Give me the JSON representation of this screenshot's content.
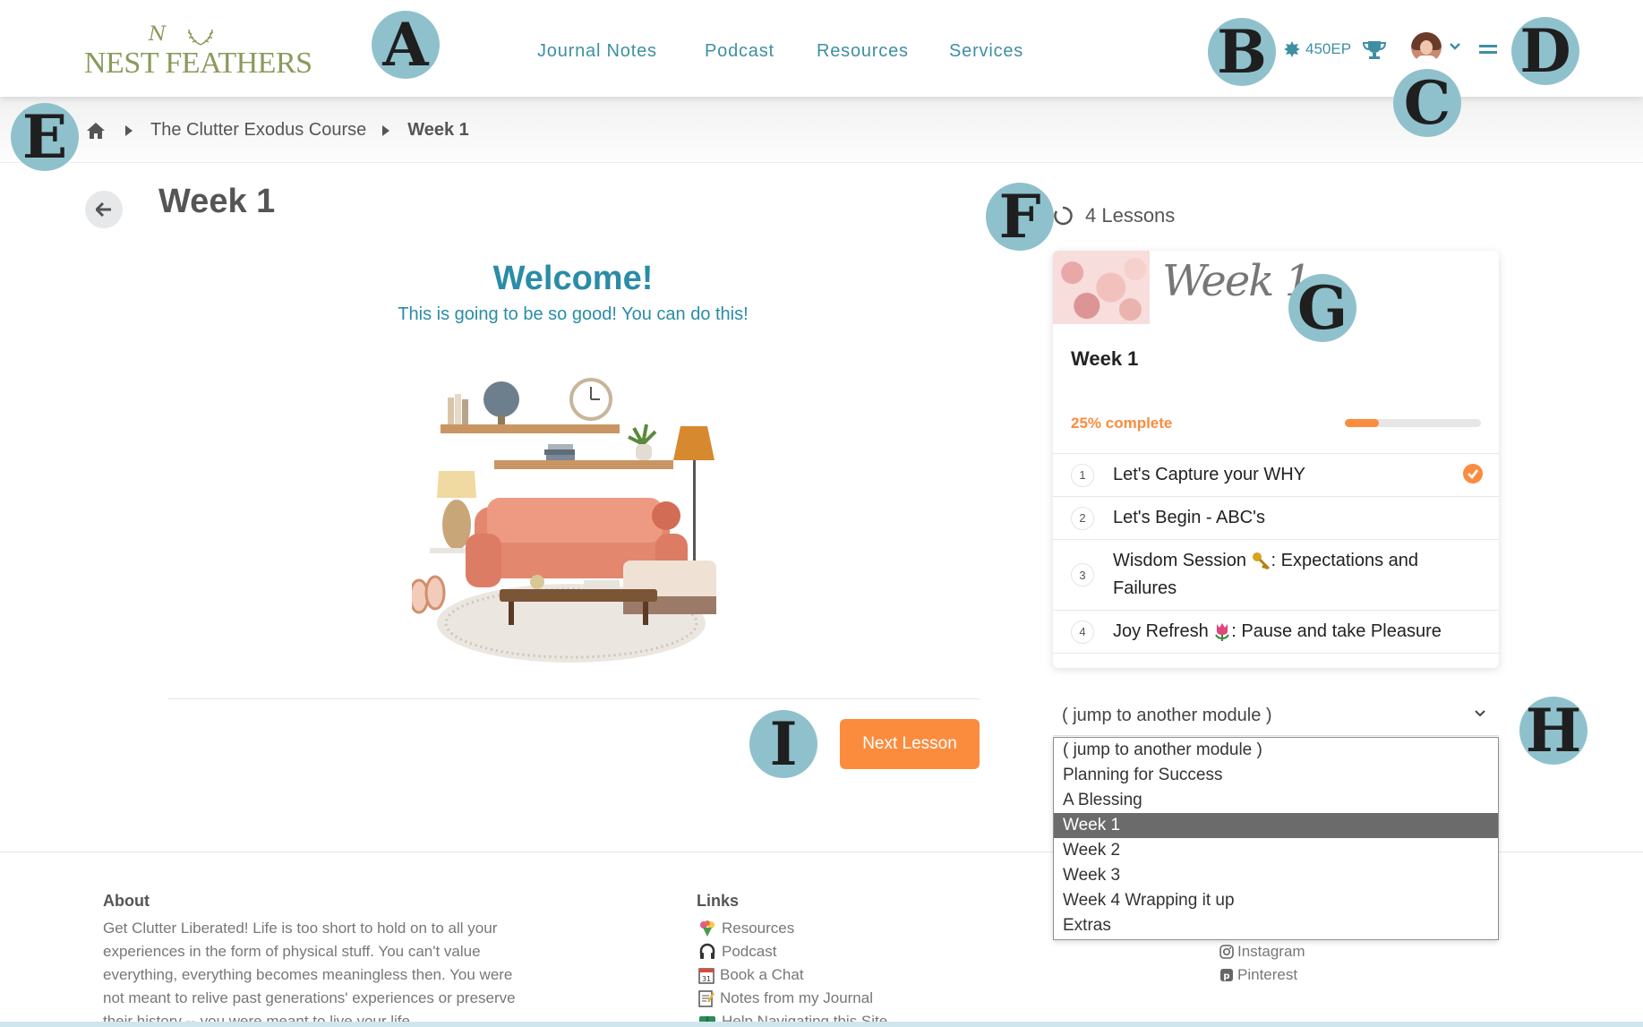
{
  "header": {
    "logo_monogram": "N",
    "logo_text": "NEST FEATHERS",
    "nav": [
      {
        "label": "Journal Notes"
      },
      {
        "label": "Podcast"
      },
      {
        "label": "Resources"
      },
      {
        "label": "Services"
      }
    ],
    "ep_label": "450EP",
    "accent_color": "#3f8fa3"
  },
  "breadcrumb": {
    "items": [
      "The Clutter Exodus Course",
      "Week 1"
    ]
  },
  "page": {
    "title": "Week 1",
    "welcome_heading": "Welcome!",
    "welcome_sub": "This is going to be so good!  You can do this!",
    "next_button": "Next Lesson"
  },
  "lessons_panel": {
    "count_label": "4 Lessons",
    "banner_script": "Week 1",
    "card_title": "Week 1",
    "progress_label": "25% complete",
    "progress_percent": 25,
    "progress_color": "#fb8c3e",
    "lessons": [
      {
        "num": "1",
        "text": "Let's Capture your WHY",
        "complete": true
      },
      {
        "num": "2",
        "text": "Let's Begin - ABC's",
        "complete": false
      },
      {
        "num": "3",
        "text_a": "Wisdom Session ",
        "icon": "key-icon",
        "text_b": ": Expectations and Failures",
        "complete": false
      },
      {
        "num": "4",
        "text_a": "Joy Refresh ",
        "icon": "tulip-icon",
        "text_b": ": Pause and take Pleasure",
        "complete": false
      }
    ]
  },
  "jump": {
    "selected": "( jump to another module )",
    "options": [
      "( jump to another module )",
      "Planning for Success",
      "A Blessing",
      "Week 1",
      "Week 2",
      "Week 3",
      "Week 4 Wrapping it up",
      "Extras"
    ],
    "highlighted": "Week 1"
  },
  "footer": {
    "about_heading": "About",
    "about_text": "Get Clutter Liberated! Life is too short to hold on to all your experiences in the form of physical stuff. You can't value everything, everything becomes meaningless then. You were not meant to relive past generations' experiences or preserve their history -- you were meant to live your life.",
    "links_heading": "Links",
    "links": [
      "Resources",
      "Podcast",
      "Book a Chat",
      "Notes from my Journal",
      "Help Navigating this Site"
    ],
    "social": [
      "Instagram",
      "Pinterest"
    ]
  },
  "markers": [
    "A",
    "B",
    "C",
    "D",
    "E",
    "F",
    "G",
    "H",
    "I"
  ]
}
